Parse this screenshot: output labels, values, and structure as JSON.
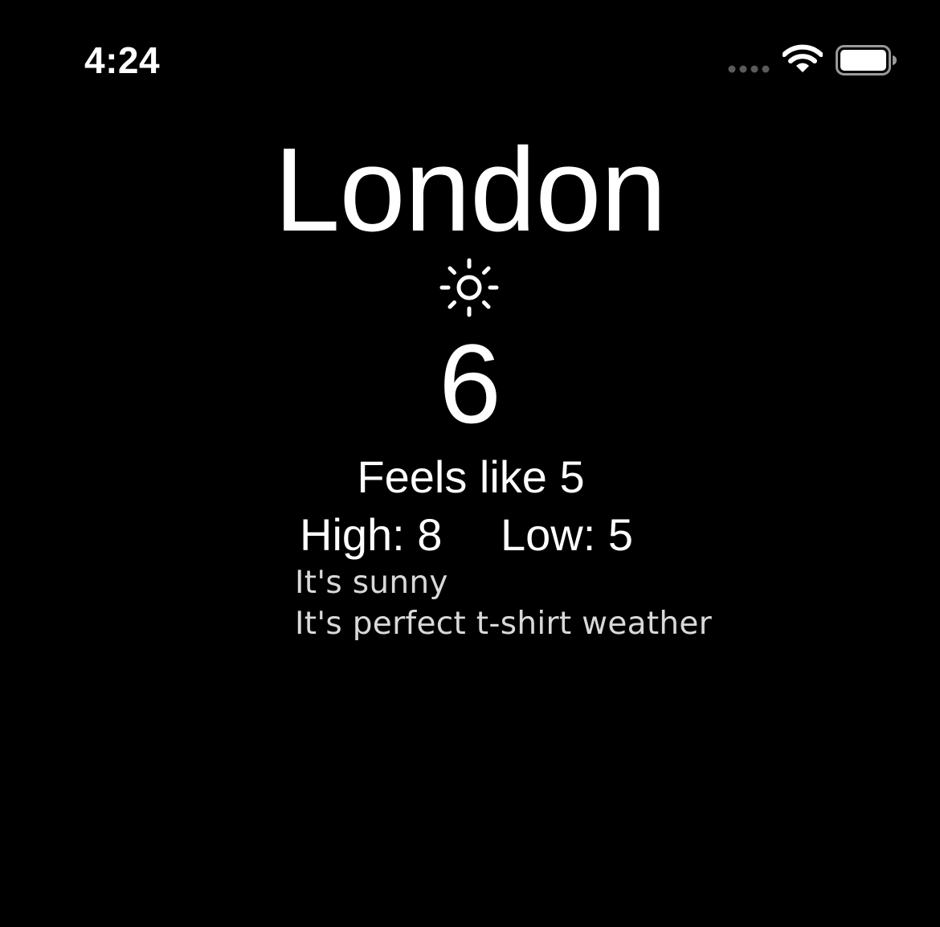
{
  "status_bar": {
    "time": "4:24",
    "signal_icon": "signal-dots-icon",
    "wifi_icon": "wifi-icon",
    "battery_icon": "battery-icon",
    "battery_level": 1.0
  },
  "weather": {
    "city": "London",
    "condition_icon": "sun-icon",
    "temperature": "6",
    "feels_like": "Feels like 5",
    "high": "High: 8",
    "low": "Low: 5",
    "description": "It's sunny",
    "advice": "It's perfect t-shirt weather"
  },
  "colors": {
    "background": "#000000",
    "text": "#ffffff",
    "secondary_text": "#d9d9d9"
  }
}
